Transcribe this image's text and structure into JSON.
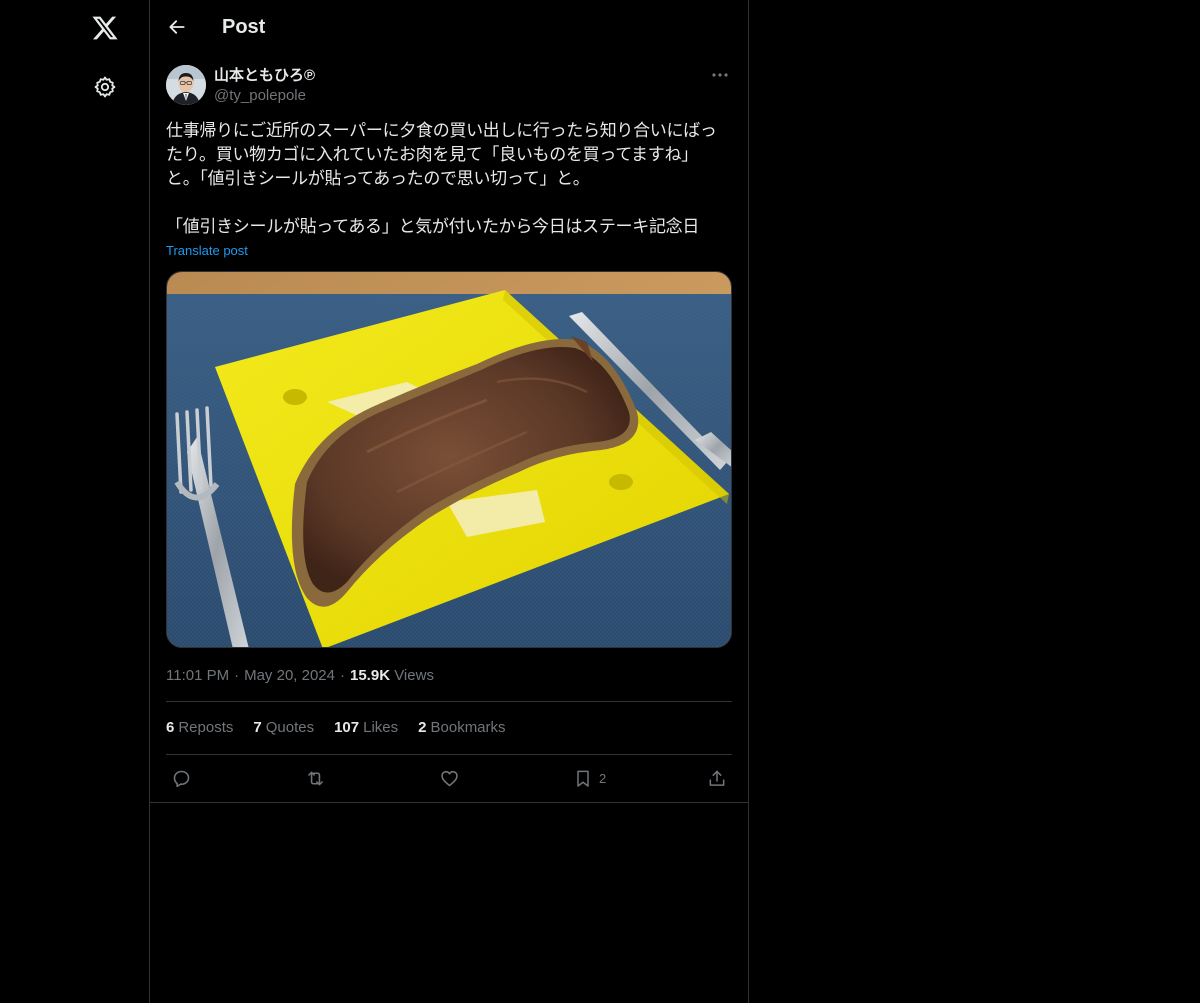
{
  "header": {
    "title": "Post"
  },
  "author": {
    "name": "山本ともひろ℗",
    "handle": "@ty_polepole"
  },
  "post": {
    "lines": [
      "仕事帰りにご近所のスーパーに夕食の買い出しに行ったら知り合いにばっ",
      "たり。買い物カゴに入れていたお肉を見て「良いものを買ってますね」",
      "と。「値引きシールが貼ってあったので思い切って」と。",
      "「値引きシールが貼ってある」と気が付いたから今日はステーキ記念日"
    ],
    "translate_label": "Translate post"
  },
  "meta": {
    "time": "11:01 PM",
    "separator": "·",
    "date": "May 20, 2024",
    "views_count": "15.9K",
    "views_label": "Views"
  },
  "stats": {
    "reposts": {
      "count": "6",
      "label": "Reposts"
    },
    "quotes": {
      "count": "7",
      "label": "Quotes"
    },
    "likes": {
      "count": "107",
      "label": "Likes"
    },
    "bookmarks": {
      "count": "2",
      "label": "Bookmarks"
    }
  },
  "actions": {
    "bookmark_count": "2"
  },
  "icons": {
    "logo": "x-logo-icon",
    "settings": "gear-icon",
    "back": "arrow-left-icon",
    "more": "more-dots-icon",
    "reply": "reply-icon",
    "repost": "repost-icon",
    "like": "heart-icon",
    "bookmark": "bookmark-icon",
    "share": "share-icon"
  },
  "colors": {
    "background": "#000000",
    "text": "#e7e9ea",
    "muted": "#71767b",
    "border": "#2f3336",
    "link": "#1d9bf0"
  }
}
